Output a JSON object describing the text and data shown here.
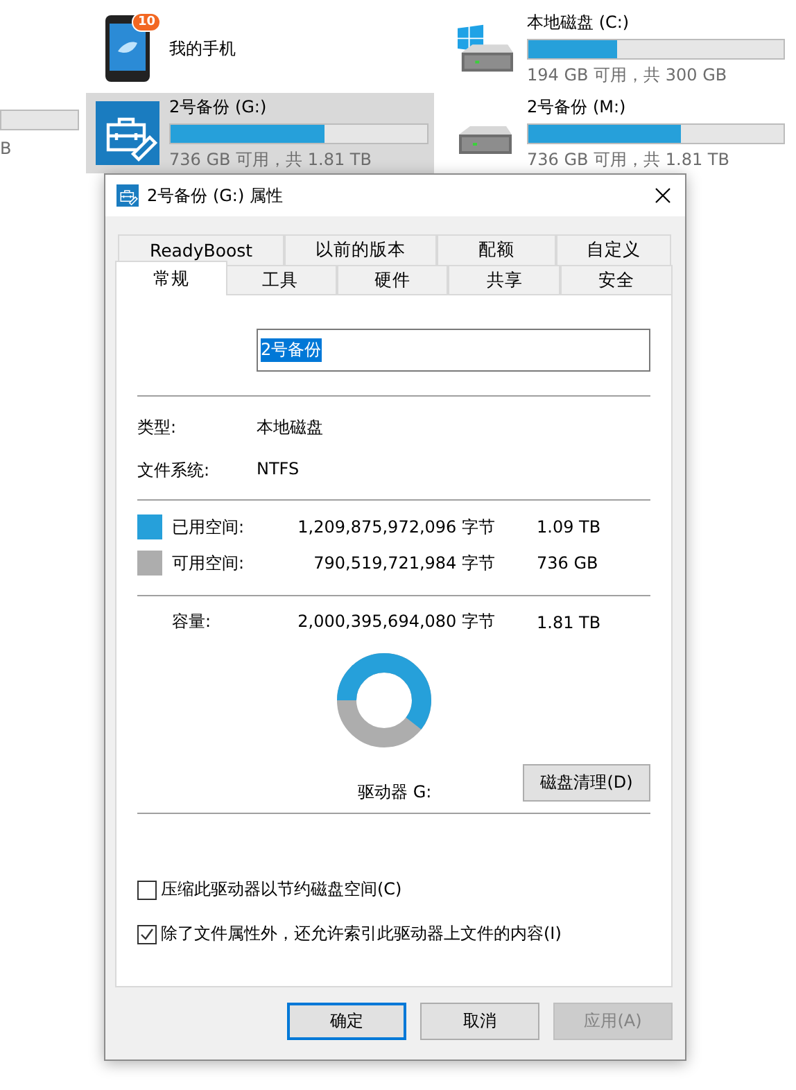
{
  "explorer": {
    "partial_tile": {
      "text": "B"
    },
    "tiles": [
      {
        "kind": "phone",
        "name": "我的手机",
        "badge": "10",
        "selected": false
      },
      {
        "kind": "system-drive",
        "name": "本地磁盘 (C:)",
        "level": 0.35,
        "detail": "194 GB 可用，共 300 GB",
        "selected": false
      },
      {
        "kind": "usb-drive",
        "name": "2号备份 (G:)",
        "level": 0.6,
        "detail": "736 GB 可用，共 1.81 TB",
        "selected": true
      },
      {
        "kind": "drive",
        "name": "2号备份 (M:)",
        "level": 0.6,
        "detail": "736 GB 可用，共 1.81 TB",
        "selected": false
      }
    ]
  },
  "dialog": {
    "title": "2号备份 (G:) 属性",
    "tab_rows": [
      [
        {
          "label": "ReadyBoost",
          "selected": false
        },
        {
          "label": "以前的版本",
          "selected": false
        },
        {
          "label": "配额",
          "selected": false
        },
        {
          "label": "自定义",
          "selected": false
        }
      ],
      [
        {
          "label": "常规",
          "selected": true
        },
        {
          "label": "工具",
          "selected": false
        },
        {
          "label": "硬件",
          "selected": false
        },
        {
          "label": "共享",
          "selected": false
        },
        {
          "label": "安全",
          "selected": false
        }
      ]
    ],
    "name_field": {
      "value": "2号备份",
      "highlighted": true
    },
    "info": [
      {
        "label": "类型:",
        "value": "本地磁盘"
      },
      {
        "label": "文件系统:",
        "value": "NTFS"
      }
    ],
    "space": [
      {
        "label": "已用空间:",
        "bytes": "1,209,875,972,096 字节",
        "size": "1.09 TB",
        "color": "#26a0da"
      },
      {
        "label": "可用空间:",
        "bytes": "790,519,721,984 字节",
        "size": "736 GB",
        "color": "#adadad"
      }
    ],
    "capacity": {
      "label": "容量:",
      "bytes": "2,000,395,694,080 字节",
      "size": "1.81 TB"
    },
    "drive_label": "驱动器 G:",
    "cleanup_button": "磁盘清理(D)",
    "options": [
      {
        "label": "压缩此驱动器以节约磁盘空间(C)",
        "checked": false
      },
      {
        "label": "除了文件属性外，还允许索引此驱动器上文件的内容(I)",
        "checked": true
      }
    ],
    "buttons": [
      {
        "label": "确定",
        "focused": true,
        "disabled": false
      },
      {
        "label": "取消",
        "focused": false,
        "disabled": false
      },
      {
        "label": "应用(A)",
        "focused": false,
        "disabled": true
      }
    ]
  }
}
